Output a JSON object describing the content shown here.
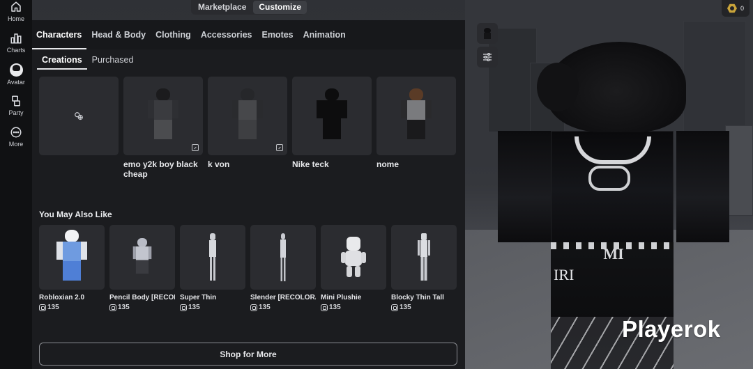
{
  "nav": {
    "items": [
      {
        "label": "Home",
        "icon": "home-icon"
      },
      {
        "label": "Charts",
        "icon": "charts-icon"
      },
      {
        "label": "Avatar",
        "icon": "avatar-icon"
      },
      {
        "label": "Party",
        "icon": "party-icon"
      },
      {
        "label": "More",
        "icon": "more-icon"
      }
    ]
  },
  "top_tabs": [
    {
      "label": "Marketplace",
      "active": false
    },
    {
      "label": "Customize",
      "active": true
    }
  ],
  "category_tabs": [
    {
      "label": "Characters",
      "active": true
    },
    {
      "label": "Head & Body",
      "active": false
    },
    {
      "label": "Clothing",
      "active": false
    },
    {
      "label": "Accessories",
      "active": false
    },
    {
      "label": "Emotes",
      "active": false
    },
    {
      "label": "Animation",
      "active": false
    }
  ],
  "sub_tabs": [
    {
      "label": "Creations",
      "active": true
    },
    {
      "label": "Purchased",
      "active": false
    }
  ],
  "creations": [
    {
      "name": "",
      "type": "create-new",
      "icon": "create-character-icon"
    },
    {
      "name": "emo y2k boy black cheap"
    },
    {
      "name": "k von"
    },
    {
      "name": "Nike teck"
    },
    {
      "name": "nome"
    }
  ],
  "recommendations": {
    "title": "You May Also Like",
    "items": [
      {
        "name": "Robloxian 2.0",
        "price": "135"
      },
      {
        "name": "Pencil Body [RECOLOR]",
        "price": "135"
      },
      {
        "name": "Super Thin",
        "price": "135"
      },
      {
        "name": "Slender [RECOLORABLE]",
        "price": "135"
      },
      {
        "name": "Mini Plushie",
        "price": "135"
      },
      {
        "name": "Blocky Thin Tall",
        "price": "135"
      }
    ]
  },
  "shop_button": {
    "label": "Shop for More"
  },
  "robux_balance": "0",
  "watermark": "Playerok",
  "avatar_shirt_text": {
    "top": "MI",
    "bottom": "IRI"
  },
  "colors": {
    "background": "#1a1b1e",
    "panel": "#1b1c1f",
    "card": "#2b2c30",
    "robux_gold": "#c9a43a"
  }
}
